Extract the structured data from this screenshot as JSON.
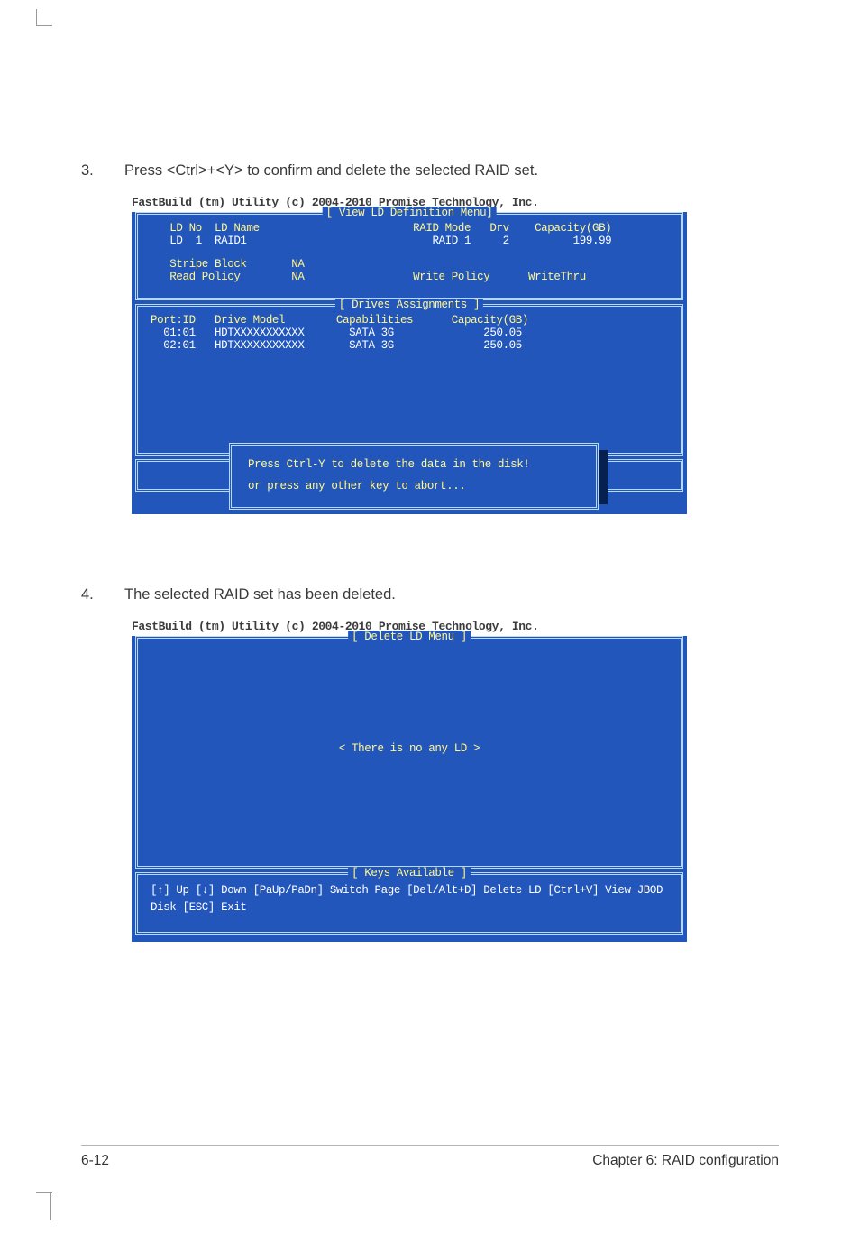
{
  "step1": {
    "num": "3.",
    "text": "Press <Ctrl>+<Y> to confirm and delete the selected RAID set."
  },
  "step2": {
    "num": "4.",
    "text": "The selected RAID set has been deleted."
  },
  "term1": {
    "caption": "FastBuild (tm) Utility (c) 2004-2010 Promise Technology, Inc.",
    "panel_a_title": "[ View LD Definition Menu]",
    "panel_b_title": "[ Drives Assignments ]",
    "ld_head": "   LD No  LD Name                        RAID Mode   Drv    Capacity(GB)",
    "ld_row": "   LD  1  RAID1                             RAID 1     2          199.99",
    "stripe": "   Stripe Block       NA",
    "read": "   Read Policy        NA                 Write Policy      WriteThru",
    "dr_head": "Port:ID   Drive Model        Capabilities      Capacity(GB)",
    "dr1": "  01:01   HDTXXXXXXXXXXX       SATA 3G              250.05",
    "dr2": "  02:01   HDTXXXXXXXXXXX       SATA 3G              250.05",
    "dlg1": "Press Ctrl-Y to delete the data in the disk!",
    "dlg2": "or press any other key to abort..."
  },
  "term2": {
    "caption": "FastBuild (tm) Utility (c) 2004-2010 Promise Technology, Inc.",
    "panel_a_title": "[ Delete LD Menu ]",
    "panel_b_title": "[ Keys Available ]",
    "empty": "< There is no any LD >",
    "keys": "[↑] Up [↓] Down [PaUp/PaDn] Switch Page [Del/Alt+D] Delete LD [Ctrl+V] View JBOD Disk  [ESC] Exit"
  },
  "footer": {
    "left": "6-12",
    "right": "Chapter 6: RAID configuration"
  }
}
